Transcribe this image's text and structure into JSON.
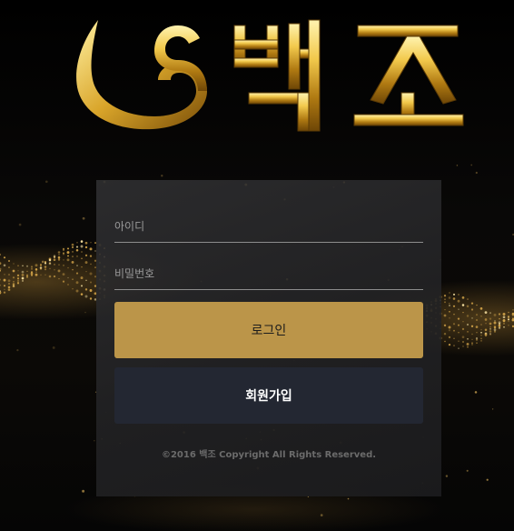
{
  "brand": {
    "name": "백조",
    "logo_icon": "swan-icon"
  },
  "colors": {
    "gold": "#bb9549",
    "navy_button": "#232732",
    "panel": "#2c2c2e"
  },
  "login_form": {
    "id_placeholder": "아이디",
    "password_placeholder": "비밀번호",
    "login_button": "로그인",
    "join_button": "회원가입"
  },
  "footer": {
    "copyright": "©2016 백조 Copyright All Rights Reserved."
  }
}
